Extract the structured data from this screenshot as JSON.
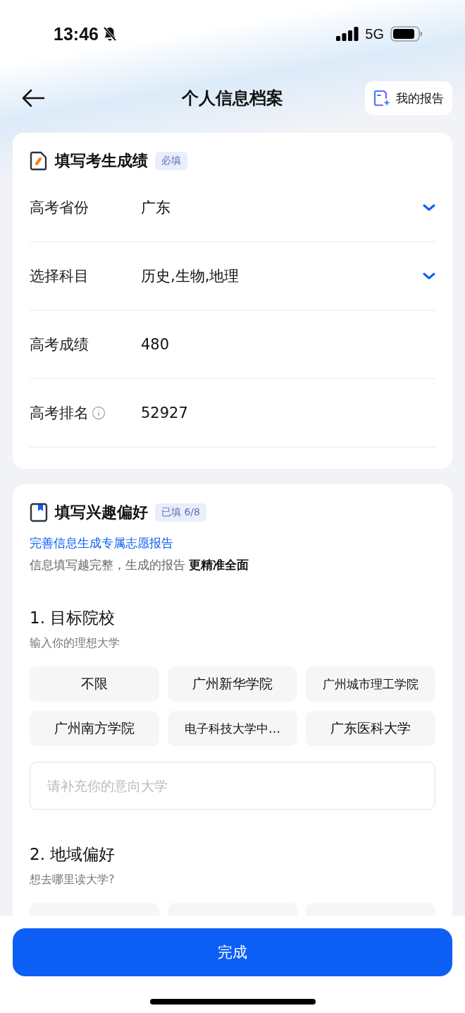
{
  "status_bar": {
    "time": "13:46",
    "network": "5G"
  },
  "header": {
    "title": "个人信息档案",
    "report_button": "我的报告"
  },
  "score_card": {
    "title": "填写考生成绩",
    "badge": "必填",
    "fields": [
      {
        "label": "高考省份",
        "value": "广东",
        "kind": "select"
      },
      {
        "label": "选择科目",
        "value": "历史,生物,地理",
        "kind": "select"
      },
      {
        "label": "高考成绩",
        "value": "480",
        "kind": "text"
      },
      {
        "label": "高考排名",
        "value": "52927",
        "kind": "info"
      }
    ]
  },
  "interest_card": {
    "title": "填写兴趣偏好",
    "badge": "已填 6/8",
    "link": "完善信息生成专属志愿报告",
    "note": "信息填写越完整，生成的报告 **更精准全面**",
    "questions": [
      {
        "title": "1. 目标院校",
        "subtitle": "输入你的理想大学",
        "options": [
          {
            "label": "不限",
            "selected": false
          },
          {
            "label": "广州新华学院",
            "selected": false
          },
          {
            "label": "广州城市理工学院",
            "selected": false
          },
          {
            "label": "广州南方学院",
            "selected": false
          },
          {
            "label": "电子科技大学中…",
            "selected": false
          },
          {
            "label": "广东医科大学",
            "selected": false
          }
        ],
        "placeholder": "请补充你的意向大学"
      },
      {
        "title": "2. 地域偏好",
        "subtitle": "想去哪里读大学?",
        "options": [
          {
            "selected": false
          },
          {
            "selected": false
          },
          {
            "selected": false
          }
        ]
      }
    ]
  },
  "footer": {
    "button": "完成"
  }
}
